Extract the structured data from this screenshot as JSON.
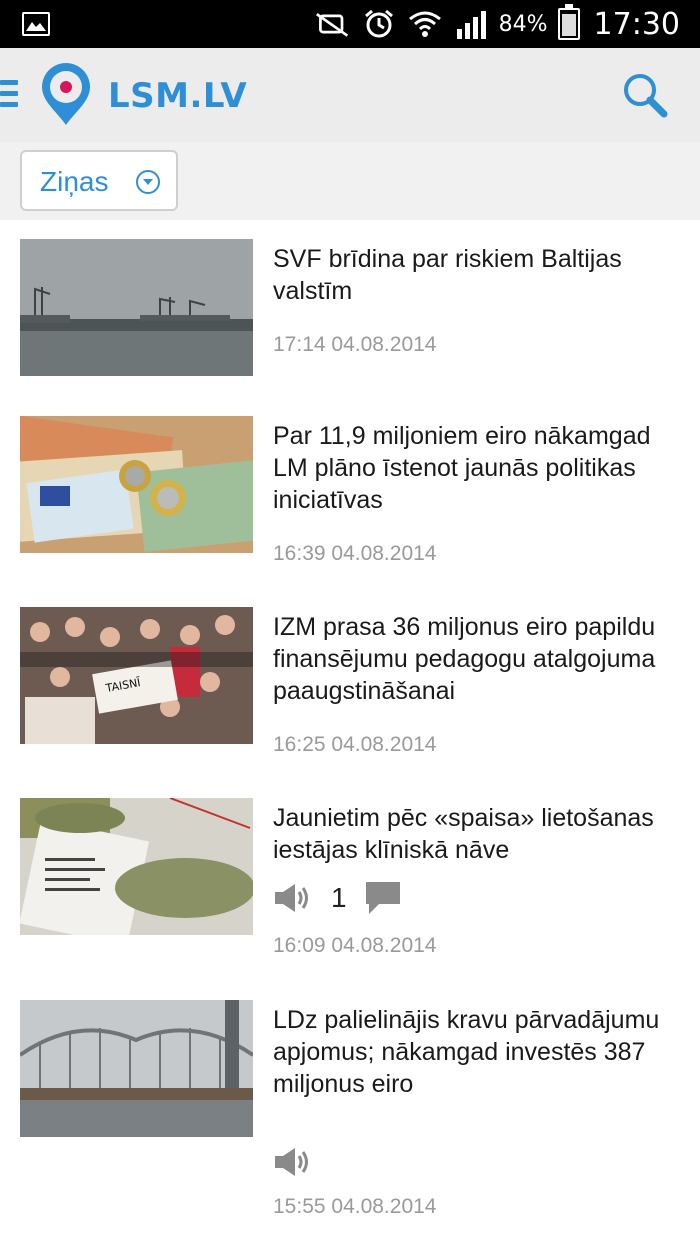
{
  "status_bar": {
    "battery_percent": "84%",
    "time": "17:30",
    "icons": [
      "image-icon",
      "mute-icon",
      "alarm-icon",
      "wifi-icon",
      "signal-icon",
      "battery-icon"
    ]
  },
  "app_bar": {
    "logo_text": "LSM.LV",
    "icons": [
      "menu-icon",
      "location-pin-icon",
      "search-icon"
    ],
    "brand_color": "#2e8fd6"
  },
  "filter": {
    "selected": "Ziņas"
  },
  "articles": [
    {
      "title": "SVF brīdina par riskiem Baltijas valstīm",
      "time": "17:14 04.08.2014",
      "image": "harbor-cranes"
    },
    {
      "title": "Par 11,9 miljoniem eiro nākamgad LM plāno īstenot jaunās politikas iniciatīvas",
      "time": "16:39 04.08.2014",
      "image": "euro-banknotes"
    },
    {
      "title": "IZM prasa 36 miljonus eiro papildu finansējumu pedagogu atalgojuma paaugstināšanai",
      "time": "16:25 04.08.2014",
      "image": "protest-crowd"
    },
    {
      "title": "Jaunietim pēc «spaisa» lietošanas iestājas klīniskā nāve",
      "time": "16:09 04.08.2014",
      "image": "herb-packets",
      "has_audio": true,
      "comments": "1"
    },
    {
      "title": "LDz palielinājis kravu pārvadājumu apjomus; nākamgad investēs 387 miljonus eiro",
      "time": "15:55 04.08.2014",
      "image": "railway-bridge",
      "has_audio": true
    }
  ]
}
